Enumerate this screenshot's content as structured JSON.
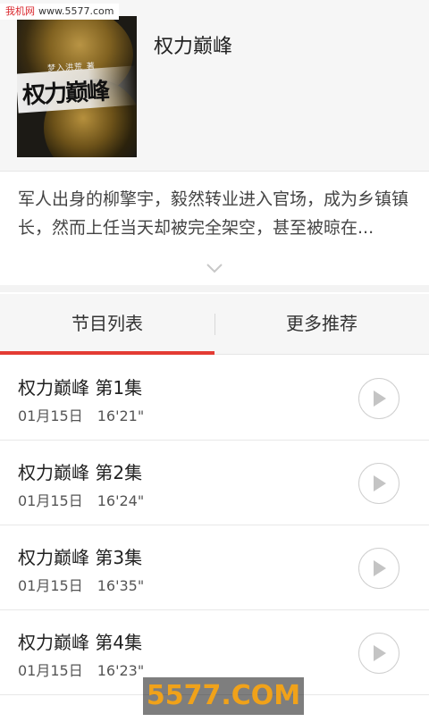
{
  "watermark_top": {
    "site": "我机网",
    "url": "www.5577.com"
  },
  "book": {
    "title": "权力巅峰",
    "cover_text": "权力巅峰",
    "cover_subtitle": "梦入洪荒 著",
    "description": "军人出身的柳擎宇，毅然转业进入官场，成为乡镇镇长，然而上任当天却被完全架空，甚至被晾在..."
  },
  "tabs": [
    {
      "label": "节目列表",
      "active": true
    },
    {
      "label": "更多推荐",
      "active": false
    }
  ],
  "episodes": [
    {
      "name": "权力巅峰 第1集",
      "date": "01月15日",
      "duration": "16'21\""
    },
    {
      "name": "权力巅峰 第2集",
      "date": "01月15日",
      "duration": "16'24\""
    },
    {
      "name": "权力巅峰 第3集",
      "date": "01月15日",
      "duration": "16'35\""
    },
    {
      "name": "权力巅峰 第4集",
      "date": "01月15日",
      "duration": "16'23\""
    }
  ],
  "watermark_bottom": "5577.COM",
  "colors": {
    "accent": "#e33b33",
    "header_bg": "#f6f6f6"
  }
}
